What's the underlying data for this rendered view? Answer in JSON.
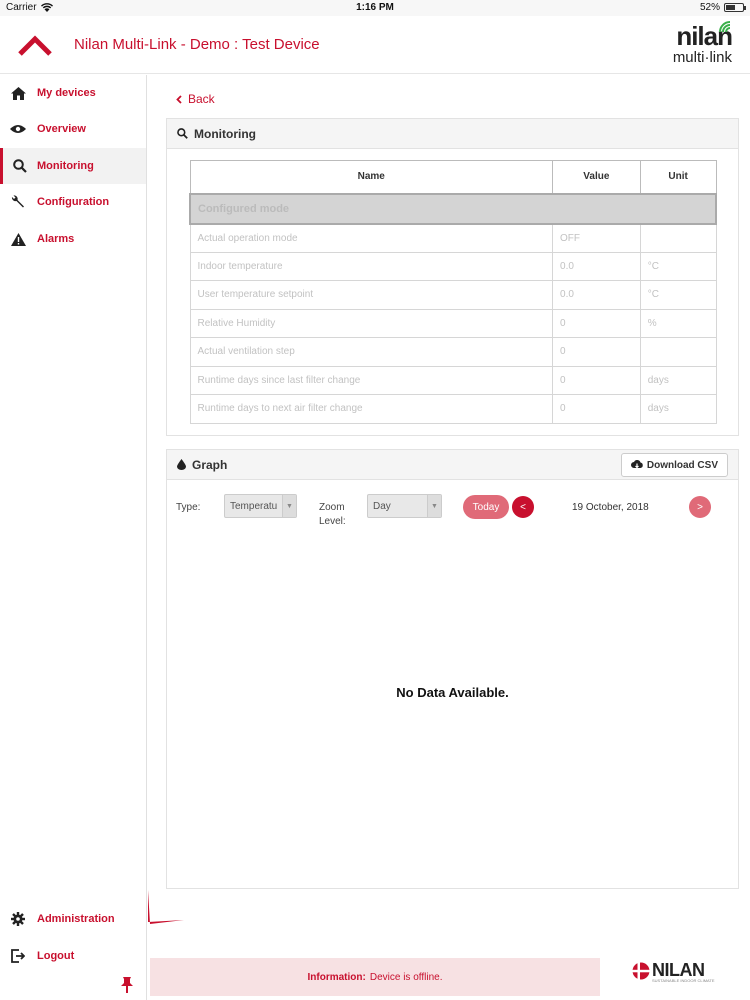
{
  "status_bar": {
    "carrier": "Carrier",
    "time": "1:16 PM",
    "battery_text": "52%",
    "battery_level": 0.52
  },
  "header": {
    "title": "Nilan Multi-Link - Demo : Test Device",
    "logo_line1": "nilan",
    "logo_line2": "multi·link"
  },
  "colors": {
    "accent": "#c8102e",
    "accent_light": "#e06a78",
    "info_bg": "#f7e1e3"
  },
  "sidebar": {
    "items": [
      {
        "label": "My devices",
        "icon": "home-icon"
      },
      {
        "label": "Overview",
        "icon": "eye-icon"
      },
      {
        "label": "Monitoring",
        "icon": "search-icon",
        "active": true
      },
      {
        "label": "Configuration",
        "icon": "wrench-icon"
      },
      {
        "label": "Alarms",
        "icon": "warning-icon"
      }
    ],
    "bottom_items": [
      {
        "label": "Administration",
        "icon": "gear-icon"
      },
      {
        "label": "Logout",
        "icon": "logout-icon"
      }
    ]
  },
  "back_label": "Back",
  "monitoring": {
    "title": "Monitoring",
    "columns": [
      "Name",
      "Value",
      "Unit"
    ],
    "group": "Configured mode",
    "rows": [
      {
        "name": "Actual operation mode",
        "value": "OFF",
        "unit": ""
      },
      {
        "name": "Indoor temperature",
        "value": "0.0",
        "unit": "°C"
      },
      {
        "name": "User temperature setpoint",
        "value": "0.0",
        "unit": "°C"
      },
      {
        "name": "Relative Humidity",
        "value": "0",
        "unit": "%"
      },
      {
        "name": "Actual ventilation step",
        "value": "0",
        "unit": ""
      },
      {
        "name": "Runtime days since last filter change",
        "value": "0",
        "unit": "days"
      },
      {
        "name": "Runtime days to next air filter change",
        "value": "0",
        "unit": "days"
      }
    ]
  },
  "graph": {
    "title": "Graph",
    "download_label": "Download CSV",
    "type_label": "Type:",
    "type_value": "Temperatu",
    "zoom_label_1": "Zoom",
    "zoom_label_2": "Level:",
    "zoom_value": "Day",
    "today_label": "Today",
    "prev_label": "<",
    "next_label": ">",
    "date": "19 October, 2018",
    "no_data": "No Data Available."
  },
  "info": {
    "prefix": "Information:",
    "message": "Device is offline."
  },
  "brand": {
    "name": "NILAN",
    "tagline": "SUSTAINABLE INDOOR CLIMATE"
  }
}
